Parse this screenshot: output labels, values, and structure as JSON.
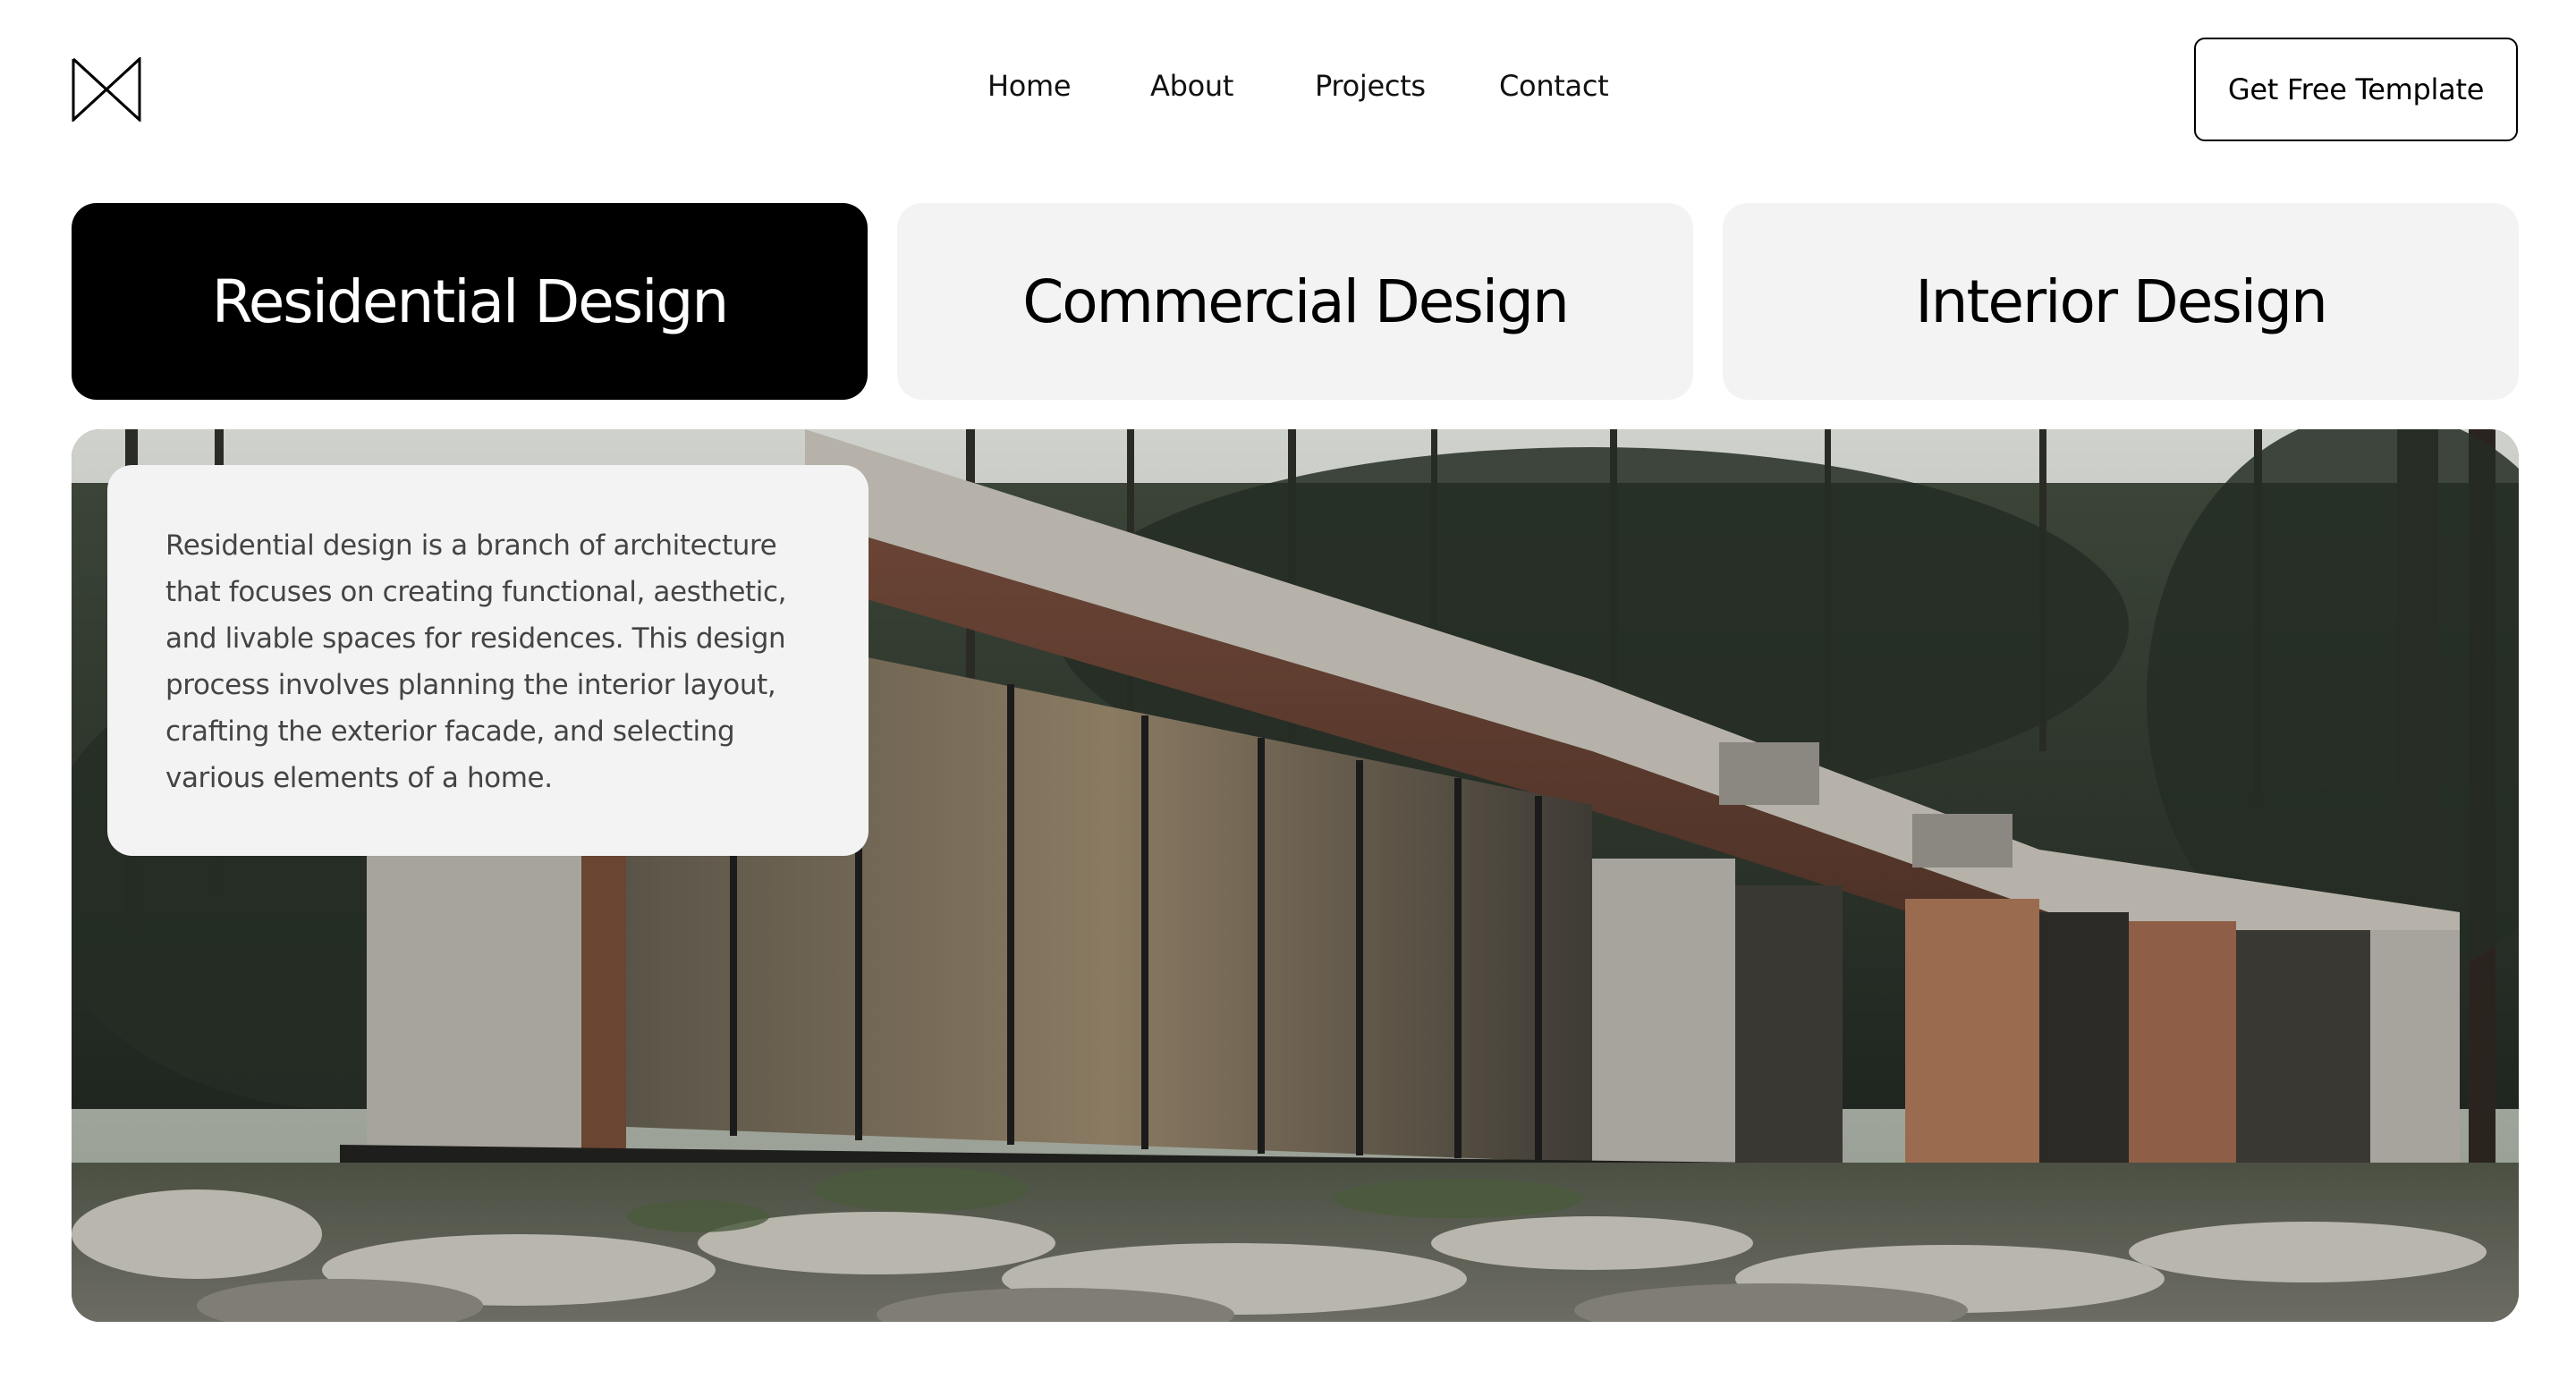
{
  "header": {
    "logo_icon": "bowtie-logo-icon",
    "nav": [
      {
        "label": "Home"
      },
      {
        "label": "About"
      },
      {
        "label": "Projects"
      },
      {
        "label": "Contact"
      }
    ],
    "cta_label": "Get Free Template"
  },
  "tabs": [
    {
      "label": "Residential Design",
      "active": true
    },
    {
      "label": "Commercial Design",
      "active": false
    },
    {
      "label": "Interior Design",
      "active": false
    }
  ],
  "hero": {
    "image": "modern-house-in-forest-photo",
    "description": "Residential design is a branch of architecture that focuses on creating functional, aesthetic, and livable spaces for residences. This design process involves planning the interior layout, crafting the exterior facade, and selecting various elements of a home."
  },
  "colors": {
    "active_tab_bg": "#000000",
    "inactive_tab_bg": "#f3f3f3",
    "card_bg": "#f3f3f3",
    "text_muted": "#444444"
  }
}
